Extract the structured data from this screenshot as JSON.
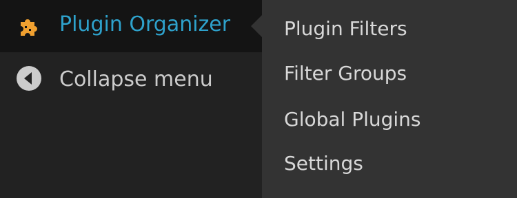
{
  "admin_menu": {
    "current_item": {
      "label": "Plugin Organizer",
      "icon": "puzzle-piece-icon",
      "color": "#2ea2cc",
      "icon_color": "#f0a030"
    },
    "collapse_item": {
      "label": "Collapse menu",
      "icon": "collapse-arrow-icon"
    }
  },
  "submenu": {
    "items": [
      {
        "label": "Plugin Filters"
      },
      {
        "label": "Filter Groups"
      },
      {
        "label": "Global Plugins"
      },
      {
        "label": "Settings"
      }
    ]
  },
  "colors": {
    "sidebar_background": "#222222",
    "active_item_background": "#141414",
    "submenu_background": "#333333",
    "text": "#cccccc"
  }
}
